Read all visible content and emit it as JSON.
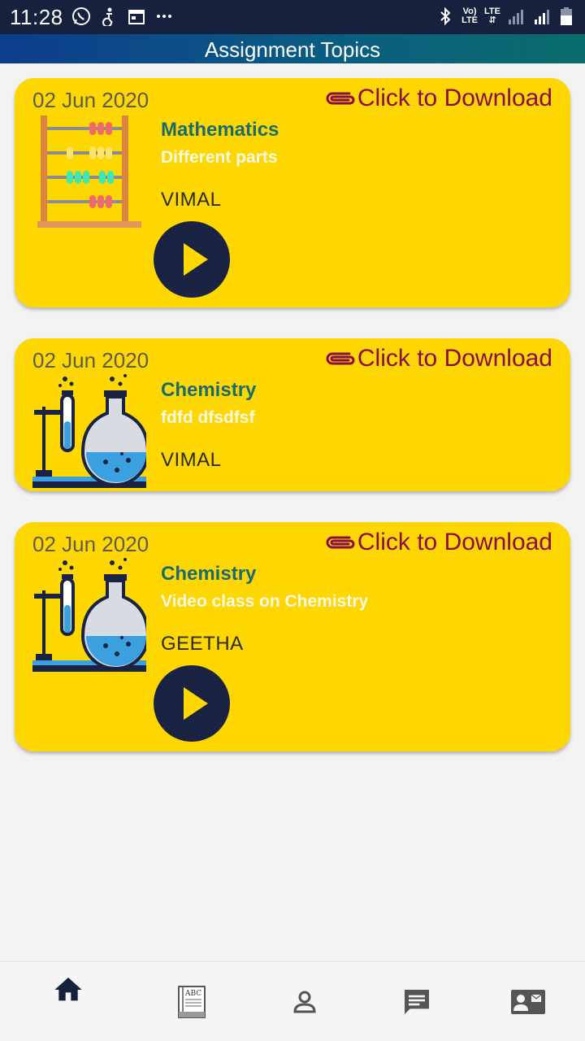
{
  "status_bar": {
    "time": "11:28",
    "volte_top": "Vo)",
    "volte_bottom": "LTE",
    "lte_label": "LTE"
  },
  "header": {
    "title": "Assignment Topics"
  },
  "cards": [
    {
      "date": "02 Jun 2020",
      "download_label": "Click to Download",
      "subject": "Mathematics",
      "topic": "Different parts",
      "teacher": "VIMAL",
      "thumbnail_icon": "abacus-icon",
      "has_video": true
    },
    {
      "date": "02 Jun 2020",
      "download_label": "Click to Download",
      "subject": "Chemistry",
      "topic": "fdfd dfsdfsf",
      "teacher": "VIMAL",
      "thumbnail_icon": "chemistry-lab-icon",
      "has_video": false
    },
    {
      "date": "02 Jun 2020",
      "download_label": "Click to Download",
      "subject": "Chemistry",
      "topic": "Video class on Chemistry",
      "teacher": "GEETHA",
      "thumbnail_icon": "chemistry-lab-icon",
      "has_video": true
    }
  ],
  "bottom_nav": {
    "items": [
      {
        "icon": "home-icon",
        "active": true
      },
      {
        "icon": "book-abc-icon",
        "active": false,
        "icon_text": "ABC"
      },
      {
        "icon": "profile-icon",
        "active": false
      },
      {
        "icon": "message-icon",
        "active": false
      },
      {
        "icon": "contact-card-icon",
        "active": false
      }
    ]
  },
  "colors": {
    "card_bg": "#ffd700",
    "subject": "#1b6b6b",
    "download": "#8a0d4a",
    "status_bar": "#16213d",
    "play_button": "#1a2442"
  }
}
